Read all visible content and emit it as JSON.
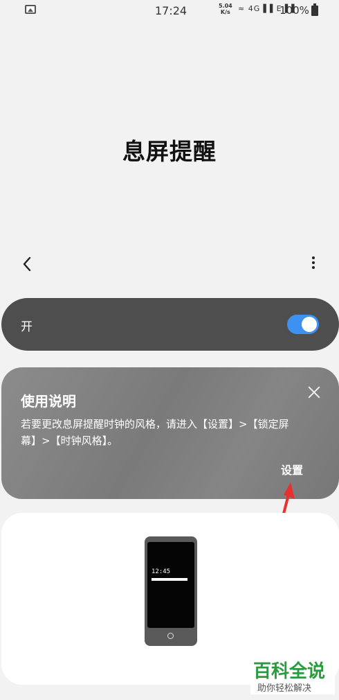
{
  "status_bar": {
    "time": "17:24",
    "net_speed_value": "5.04",
    "net_speed_unit": "K/s",
    "signal_icons": "≈ 4G▐▐ E▐▐",
    "battery": "100%"
  },
  "header": {
    "title": "息屏提醒"
  },
  "switch": {
    "label": "开",
    "state": "on",
    "accent": "#3e91f0"
  },
  "info_card": {
    "title": "使用说明",
    "text": "若要更改息屏提醒时钟的风格，请进入【设置】>【锁定屏幕】>【时钟风格】。",
    "action_label": "设置"
  },
  "preview": {
    "clock": "12:45"
  },
  "watermark": {
    "main": "百科全说",
    "sub": "助你轻松解决",
    "color": "#2a9b3c"
  }
}
